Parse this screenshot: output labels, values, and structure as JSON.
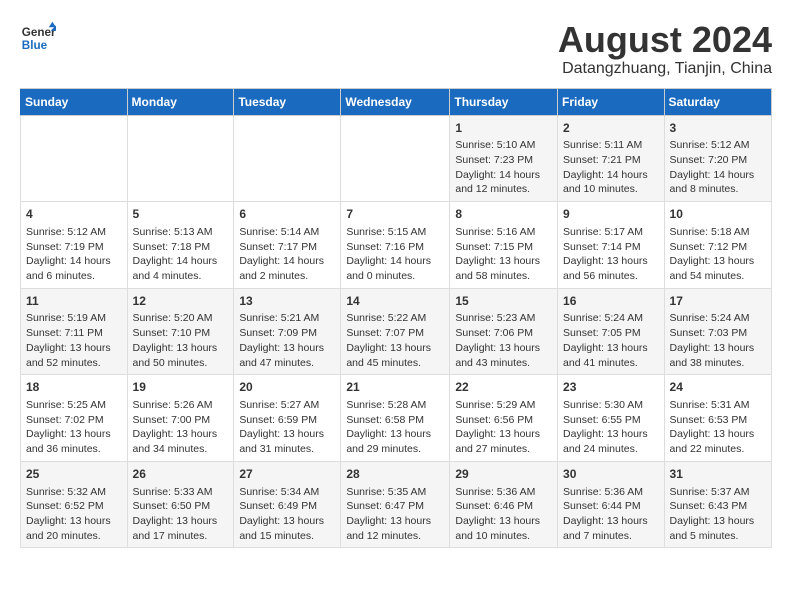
{
  "logo": {
    "text_general": "General",
    "text_blue": "Blue"
  },
  "title": "August 2024",
  "subtitle": "Datangzhuang, Tianjin, China",
  "days_of_week": [
    "Sunday",
    "Monday",
    "Tuesday",
    "Wednesday",
    "Thursday",
    "Friday",
    "Saturday"
  ],
  "weeks": [
    [
      {
        "day": "",
        "content": ""
      },
      {
        "day": "",
        "content": ""
      },
      {
        "day": "",
        "content": ""
      },
      {
        "day": "",
        "content": ""
      },
      {
        "day": "1",
        "content": "Sunrise: 5:10 AM\nSunset: 7:23 PM\nDaylight: 14 hours and 12 minutes."
      },
      {
        "day": "2",
        "content": "Sunrise: 5:11 AM\nSunset: 7:21 PM\nDaylight: 14 hours and 10 minutes."
      },
      {
        "day": "3",
        "content": "Sunrise: 5:12 AM\nSunset: 7:20 PM\nDaylight: 14 hours and 8 minutes."
      }
    ],
    [
      {
        "day": "4",
        "content": "Sunrise: 5:12 AM\nSunset: 7:19 PM\nDaylight: 14 hours and 6 minutes."
      },
      {
        "day": "5",
        "content": "Sunrise: 5:13 AM\nSunset: 7:18 PM\nDaylight: 14 hours and 4 minutes."
      },
      {
        "day": "6",
        "content": "Sunrise: 5:14 AM\nSunset: 7:17 PM\nDaylight: 14 hours and 2 minutes."
      },
      {
        "day": "7",
        "content": "Sunrise: 5:15 AM\nSunset: 7:16 PM\nDaylight: 14 hours and 0 minutes."
      },
      {
        "day": "8",
        "content": "Sunrise: 5:16 AM\nSunset: 7:15 PM\nDaylight: 13 hours and 58 minutes."
      },
      {
        "day": "9",
        "content": "Sunrise: 5:17 AM\nSunset: 7:14 PM\nDaylight: 13 hours and 56 minutes."
      },
      {
        "day": "10",
        "content": "Sunrise: 5:18 AM\nSunset: 7:12 PM\nDaylight: 13 hours and 54 minutes."
      }
    ],
    [
      {
        "day": "11",
        "content": "Sunrise: 5:19 AM\nSunset: 7:11 PM\nDaylight: 13 hours and 52 minutes."
      },
      {
        "day": "12",
        "content": "Sunrise: 5:20 AM\nSunset: 7:10 PM\nDaylight: 13 hours and 50 minutes."
      },
      {
        "day": "13",
        "content": "Sunrise: 5:21 AM\nSunset: 7:09 PM\nDaylight: 13 hours and 47 minutes."
      },
      {
        "day": "14",
        "content": "Sunrise: 5:22 AM\nSunset: 7:07 PM\nDaylight: 13 hours and 45 minutes."
      },
      {
        "day": "15",
        "content": "Sunrise: 5:23 AM\nSunset: 7:06 PM\nDaylight: 13 hours and 43 minutes."
      },
      {
        "day": "16",
        "content": "Sunrise: 5:24 AM\nSunset: 7:05 PM\nDaylight: 13 hours and 41 minutes."
      },
      {
        "day": "17",
        "content": "Sunrise: 5:24 AM\nSunset: 7:03 PM\nDaylight: 13 hours and 38 minutes."
      }
    ],
    [
      {
        "day": "18",
        "content": "Sunrise: 5:25 AM\nSunset: 7:02 PM\nDaylight: 13 hours and 36 minutes."
      },
      {
        "day": "19",
        "content": "Sunrise: 5:26 AM\nSunset: 7:00 PM\nDaylight: 13 hours and 34 minutes."
      },
      {
        "day": "20",
        "content": "Sunrise: 5:27 AM\nSunset: 6:59 PM\nDaylight: 13 hours and 31 minutes."
      },
      {
        "day": "21",
        "content": "Sunrise: 5:28 AM\nSunset: 6:58 PM\nDaylight: 13 hours and 29 minutes."
      },
      {
        "day": "22",
        "content": "Sunrise: 5:29 AM\nSunset: 6:56 PM\nDaylight: 13 hours and 27 minutes."
      },
      {
        "day": "23",
        "content": "Sunrise: 5:30 AM\nSunset: 6:55 PM\nDaylight: 13 hours and 24 minutes."
      },
      {
        "day": "24",
        "content": "Sunrise: 5:31 AM\nSunset: 6:53 PM\nDaylight: 13 hours and 22 minutes."
      }
    ],
    [
      {
        "day": "25",
        "content": "Sunrise: 5:32 AM\nSunset: 6:52 PM\nDaylight: 13 hours and 20 minutes."
      },
      {
        "day": "26",
        "content": "Sunrise: 5:33 AM\nSunset: 6:50 PM\nDaylight: 13 hours and 17 minutes."
      },
      {
        "day": "27",
        "content": "Sunrise: 5:34 AM\nSunset: 6:49 PM\nDaylight: 13 hours and 15 minutes."
      },
      {
        "day": "28",
        "content": "Sunrise: 5:35 AM\nSunset: 6:47 PM\nDaylight: 13 hours and 12 minutes."
      },
      {
        "day": "29",
        "content": "Sunrise: 5:36 AM\nSunset: 6:46 PM\nDaylight: 13 hours and 10 minutes."
      },
      {
        "day": "30",
        "content": "Sunrise: 5:36 AM\nSunset: 6:44 PM\nDaylight: 13 hours and 7 minutes."
      },
      {
        "day": "31",
        "content": "Sunrise: 5:37 AM\nSunset: 6:43 PM\nDaylight: 13 hours and 5 minutes."
      }
    ]
  ]
}
